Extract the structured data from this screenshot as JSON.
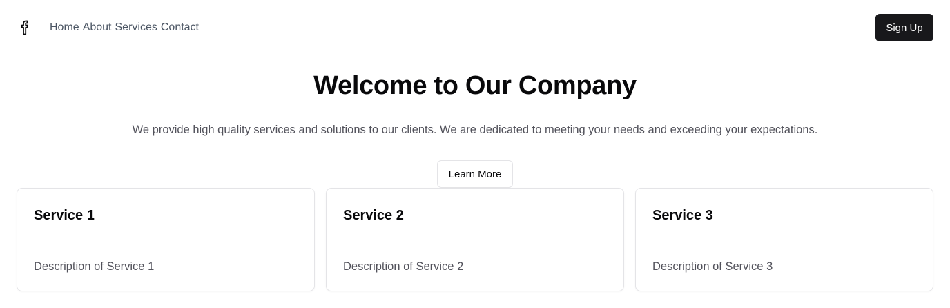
{
  "header": {
    "logo_icon": "facebook-icon",
    "nav": [
      "Home",
      "About",
      "Services",
      "Contact"
    ],
    "signup_label": "Sign Up"
  },
  "hero": {
    "title": "Welcome to Our Company",
    "subtitle": "We provide high quality services and solutions to our clients. We are dedicated to meeting your needs and exceeding your expectations.",
    "cta_label": "Learn More"
  },
  "services": [
    {
      "title": "Service 1",
      "description": "Description of Service 1"
    },
    {
      "title": "Service 2",
      "description": "Description of Service 2"
    },
    {
      "title": "Service 3",
      "description": "Description of Service 3"
    }
  ],
  "colors": {
    "primary_button": "#18181b",
    "muted_text": "#52525b",
    "border": "#e4e4e7"
  }
}
